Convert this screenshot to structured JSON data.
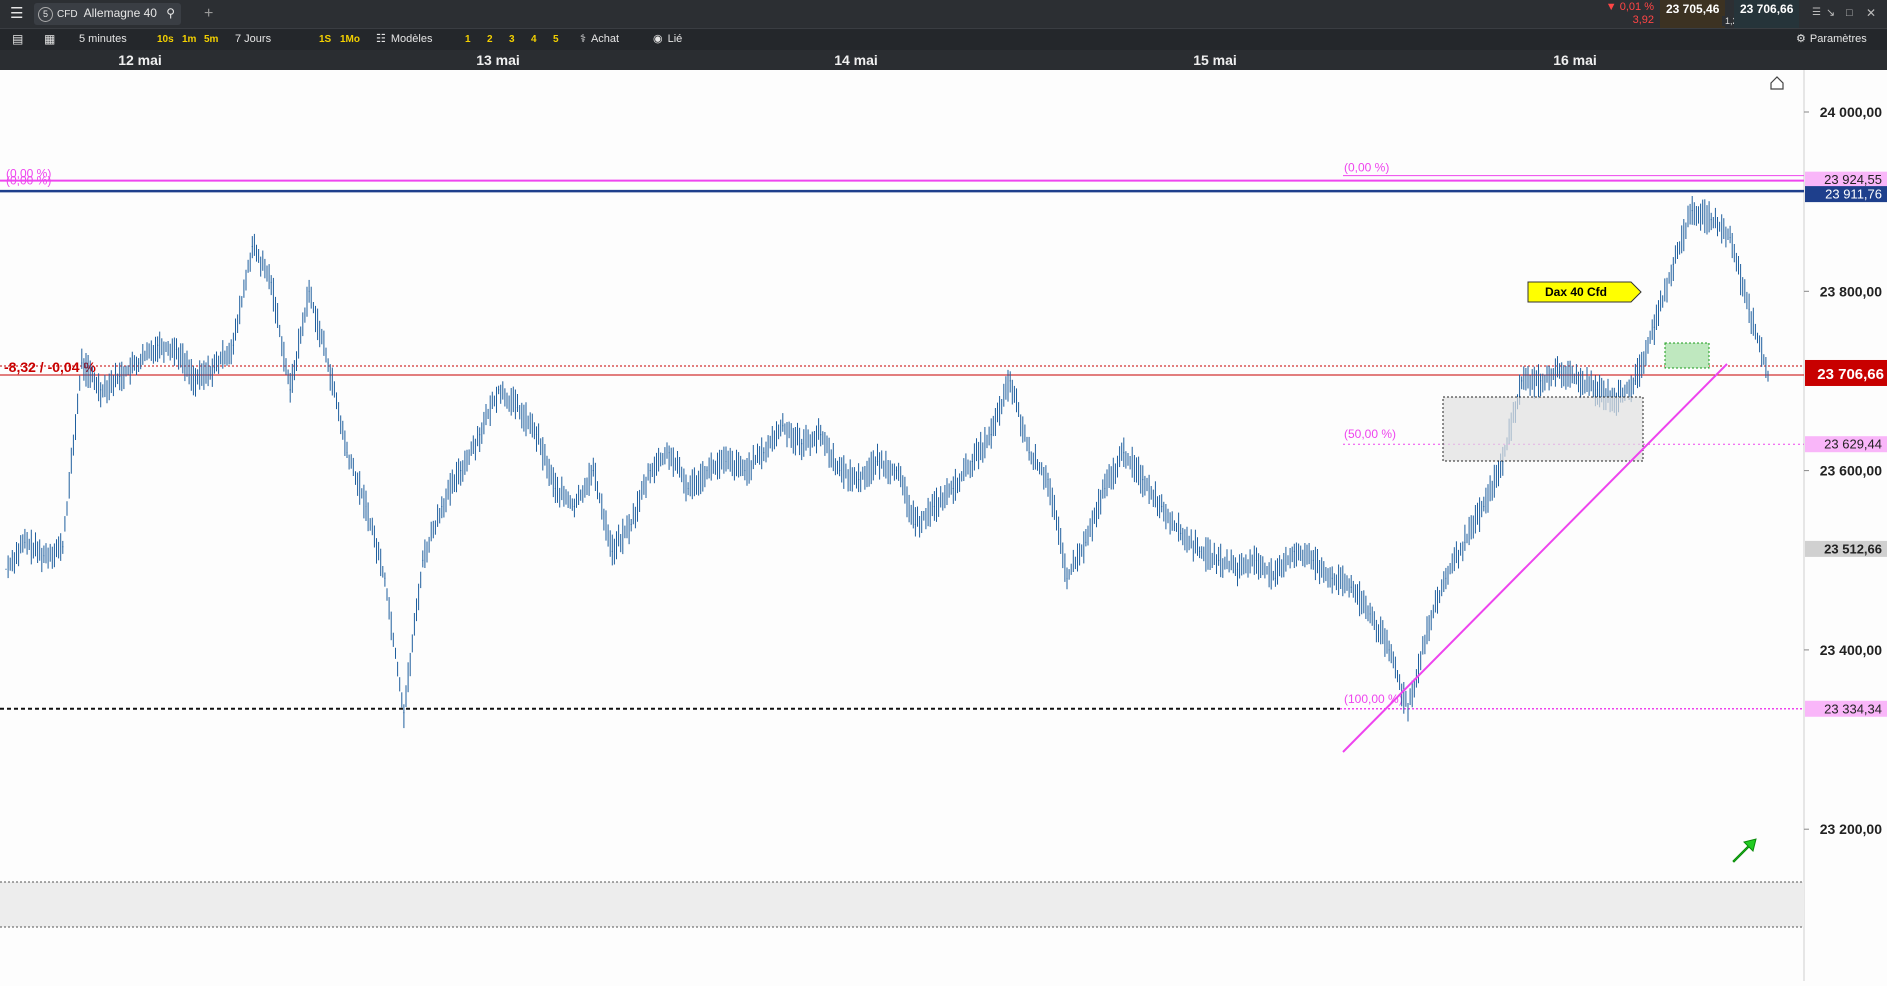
{
  "header": {
    "menu_icon": "hamburger-icon",
    "instrument_badge": "5",
    "instrument_type": "CFD",
    "instrument_name": "Allemagne 40",
    "search_icon": "search-icon",
    "add_tab": "+",
    "change_pct": "▼ 0,01 %",
    "change_abs": "3,92",
    "sell_price": "23 705,46",
    "buy_price": "23 706,66",
    "spread": "1,20"
  },
  "toolbar": {
    "timeframe": "5 minutes",
    "quick_intervals": [
      "10s",
      "1m",
      "5m"
    ],
    "period": "7 Jours",
    "period_buttons": [
      "1S",
      "1Mo"
    ],
    "models_label": "Modèles",
    "layout_buttons": [
      "1",
      "2",
      "3",
      "4",
      "5"
    ],
    "buy_label": "Achat",
    "linked_label": "Lié",
    "settings_label": "Paramètres"
  },
  "dates": [
    "12 mai",
    "13 mai",
    "14 mai",
    "15 mai",
    "16 mai"
  ],
  "colors": {
    "candle": "#1f5f9e",
    "fib": "#ee44ee",
    "resistance": "#1e3f8c",
    "current_price": "#c80000",
    "annotation_bg": "#ffff00",
    "arrow": "#22cc22"
  },
  "chart_data": {
    "type": "line",
    "instrument": "Allemagne 40",
    "interval": "5 minutes",
    "categories": [
      "12 mai",
      "13 mai",
      "14 mai",
      "15 mai",
      "16 mai"
    ],
    "ylim": [
      23200,
      24060
    ],
    "y_ticks": [
      "24 000,00",
      "23 800,00",
      "23 600,00",
      "23 400,00",
      "23 200,00"
    ],
    "series": [
      {
        "values": [
          23490,
          23520,
          23505,
          23515,
          23720,
          23690,
          23705,
          23720,
          23740,
          23735,
          23700,
          23715,
          23740,
          23850,
          23810,
          23690,
          23800,
          23720,
          23620,
          23560,
          23480,
          23330,
          23500,
          23560,
          23600,
          23640,
          23690,
          23670,
          23640,
          23580,
          23560,
          23600,
          23510,
          23540,
          23600,
          23620,
          23580,
          23600,
          23610,
          23600,
          23620,
          23650,
          23630,
          23640,
          23600,
          23590,
          23610,
          23600,
          23540,
          23560,
          23580,
          23610,
          23640,
          23700,
          23620,
          23590,
          23480,
          23520,
          23580,
          23620,
          23590,
          23560,
          23530,
          23510,
          23500,
          23490,
          23500,
          23480,
          23510,
          23500,
          23480,
          23470,
          23440,
          23400,
          23334,
          23420,
          23480,
          23520,
          23560,
          23610,
          23700,
          23700,
          23710,
          23700,
          23690,
          23680,
          23700,
          23760,
          23830,
          23890,
          23880,
          23860,
          23780,
          23706.66
        ]
      }
    ],
    "current_price": "23 706,66",
    "current_change": "-8,32 / -0,04 %",
    "levels": [
      {
        "label": "23 924,55",
        "value": 23924.55,
        "kind": "fib"
      },
      {
        "label": "23 911,76",
        "value": 23911.76,
        "kind": "resistance"
      },
      {
        "label": "23 629,44",
        "value": 23629.44,
        "kind": "fib"
      },
      {
        "label": "23 512,66",
        "value": 23512.66,
        "kind": "grey"
      },
      {
        "label": "23 334,34",
        "value": 23334.34,
        "kind": "fib"
      }
    ],
    "fib_labels": [
      "(0,00 %)",
      "(50,00 %)",
      "(100,00 %)"
    ],
    "left_fib_labels": [
      "(0,00 %)",
      "(0,00 %)"
    ],
    "annotation": "Dax 40 Cfd"
  }
}
